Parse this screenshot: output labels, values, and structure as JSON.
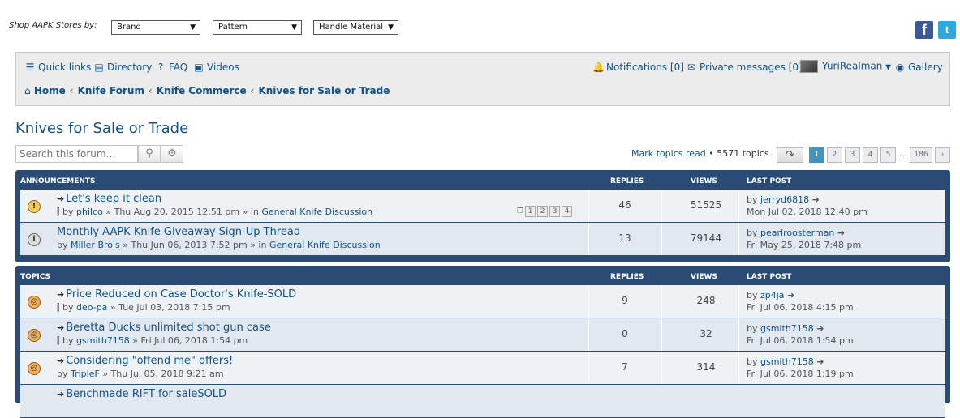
{
  "shopbar": {
    "label": "Shop AAPK Stores by:",
    "selects": [
      "Brand",
      "Pattern",
      "Handle Material"
    ],
    "facebook": "f",
    "twitter": "t"
  },
  "nav": {
    "quick_links": "Quick links",
    "directory": "Directory",
    "faq": "FAQ",
    "videos": "Videos",
    "notifications": "Notifications [0]",
    "private_messages": "Private messages [0]",
    "user": "YuriRealman",
    "gallery": "Gallery",
    "breadcrumbs": [
      "Home",
      "Knife Forum",
      "Knife Commerce",
      "Knives for Sale or Trade"
    ]
  },
  "page": {
    "title": "Knives for Sale or Trade",
    "search_placeholder": "Search this forum…",
    "mark_read": "Mark topics read",
    "topic_count": "• 5571 topics",
    "pages": [
      "1",
      "2",
      "3",
      "4",
      "5",
      "186"
    ],
    "ellipsis": "…"
  },
  "announcements": {
    "header": "ANNOUNCEMENTS",
    "col_replies": "REPLIES",
    "col_views": "VIEWS",
    "col_last": "LAST POST",
    "rows": [
      {
        "title": "Let's keep it clean",
        "by_prefix": "by",
        "author": "philco",
        "date": "» Thu Aug 20, 2015 12:51 pm » in",
        "forum": "General Knife Discussion",
        "pages": [
          "1",
          "2",
          "3",
          "4"
        ],
        "replies": "46",
        "views": "51525",
        "last_by": "by",
        "last_author": "jerryd6818",
        "last_date": "Mon Jul 02, 2018 12:40 pm"
      },
      {
        "title": "Monthly AAPK Knife Giveaway Sign-Up Thread",
        "by_prefix": "by",
        "author": "Miller Bro's",
        "date": "» Thu Jun 06, 2013 7:52 pm » in",
        "forum": "General Knife Discussion",
        "replies": "13",
        "views": "79144",
        "last_by": "by",
        "last_author": "pearlroosterman",
        "last_date": "Fri May 25, 2018 7:48 pm"
      }
    ]
  },
  "topics": {
    "header": "TOPICS",
    "col_replies": "REPLIES",
    "col_views": "VIEWS",
    "col_last": "LAST POST",
    "rows": [
      {
        "title": "Price Reduced on Case Doctor's Knife-SOLD",
        "by_prefix": "by",
        "author": "deo-pa",
        "date": "» Tue Jul 03, 2018 7:15 pm",
        "replies": "9",
        "views": "248",
        "last_by": "by",
        "last_author": "zp4ja",
        "last_date": "Fri Jul 06, 2018 4:15 pm"
      },
      {
        "title": "Beretta Ducks unlimited shot gun case",
        "by_prefix": "by",
        "author": "gsmith7158",
        "date": "» Fri Jul 06, 2018 1:54 pm",
        "replies": "0",
        "views": "32",
        "last_by": "by",
        "last_author": "gsmith7158",
        "last_date": "Fri Jul 06, 2018 1:54 pm"
      },
      {
        "title": "Considering \"offend me\" offers!",
        "by_prefix": "by",
        "author": "TripleF",
        "date": "» Thu Jul 05, 2018 9:21 am",
        "replies": "7",
        "views": "314",
        "last_by": "by",
        "last_author": "gsmith7158",
        "last_date": "Fri Jul 06, 2018 1:19 pm"
      },
      {
        "title": "Benchmade RIFT for saleSOLD"
      }
    ]
  }
}
